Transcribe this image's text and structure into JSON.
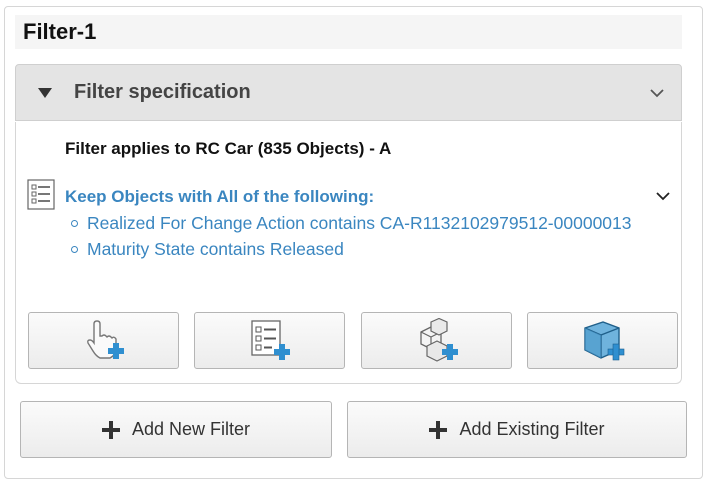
{
  "filter": {
    "title": "Filter-1",
    "section_title": "Filter specification",
    "applies_text": "Filter applies to RC Car (835 Objects) - A",
    "keep_text": "Keep Objects with All of the following:",
    "conditions": [
      "Realized For Change Action contains CA-R1132102979512-00000013",
      "Maturity State contains Released"
    ]
  },
  "tools": [
    {
      "icon": "hand-pointer-add-icon"
    },
    {
      "icon": "list-add-icon"
    },
    {
      "icon": "assembly-add-icon"
    },
    {
      "icon": "volume-box-add-icon"
    }
  ],
  "actions": {
    "add_new": "Add New Filter",
    "add_existing": "Add Existing Filter"
  },
  "colors": {
    "link": "#3a86c0",
    "plus": "#2f8fd0"
  }
}
